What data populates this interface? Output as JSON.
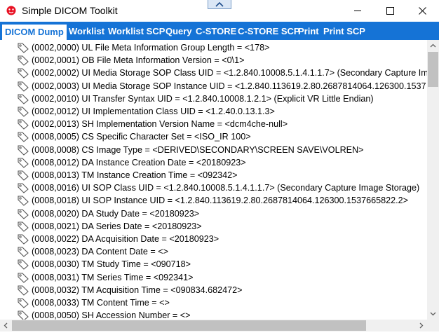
{
  "window": {
    "title": "Simple DICOM Toolkit"
  },
  "tabs": [
    {
      "label": "DICOM Dump",
      "active": true
    },
    {
      "label": "Worklist"
    },
    {
      "label": "Worklist SCP"
    },
    {
      "label": "Query"
    },
    {
      "label": "C-STORE"
    },
    {
      "label": "C-STORE SCP"
    },
    {
      "label": "Print"
    },
    {
      "label": "Print SCP"
    }
  ],
  "colors": {
    "accent": "#1573d6",
    "app_icon": "#e81123"
  },
  "tree_rows": [
    "(0002,0000) UL File Meta Information Group Length = <178>",
    "(0002,0001) OB File Meta Information Version = <0\\1>",
    "(0002,0002) UI Media Storage SOP Class UID = <1.2.840.10008.5.1.4.1.1.7> (Secondary Capture Im",
    "(0002,0003) UI Media Storage SOP Instance UID = <1.2.840.113619.2.80.2687814064.126300.1537",
    "(0002,0010) UI Transfer Syntax UID = <1.2.840.10008.1.2.1> (Explicit VR Little Endian)",
    "(0002,0012) UI Implementation Class UID = <1.2.40.0.13.1.3>",
    "(0002,0013) SH Implementation Version Name = <dcm4che-null>",
    "(0008,0005) CS Specific Character Set = <ISO_IR 100>",
    "(0008,0008) CS Image Type = <DERIVED\\SECONDARY\\SCREEN SAVE\\VOLREN>",
    "(0008,0012) DA Instance Creation Date = <20180923>",
    "(0008,0013) TM Instance Creation Time = <092342>",
    "(0008,0016) UI SOP Class UID = <1.2.840.10008.5.1.4.1.1.7> (Secondary Capture Image Storage)",
    "(0008,0018) UI SOP Instance UID = <1.2.840.113619.2.80.2687814064.126300.1537665822.2>",
    "(0008,0020) DA Study Date = <20180923>",
    "(0008,0021) DA Series Date = <20180923>",
    "(0008,0022) DA Acquisition Date = <20180923>",
    "(0008,0023) DA Content Date = <>",
    "(0008,0030) TM Study Time = <090718>",
    "(0008,0031) TM Series Time = <092341>",
    "(0008,0032) TM Acquisition Time = <090834.682472>",
    "(0008,0033) TM Content Time = <>",
    "(0008,0050) SH Accession Number = <>"
  ]
}
